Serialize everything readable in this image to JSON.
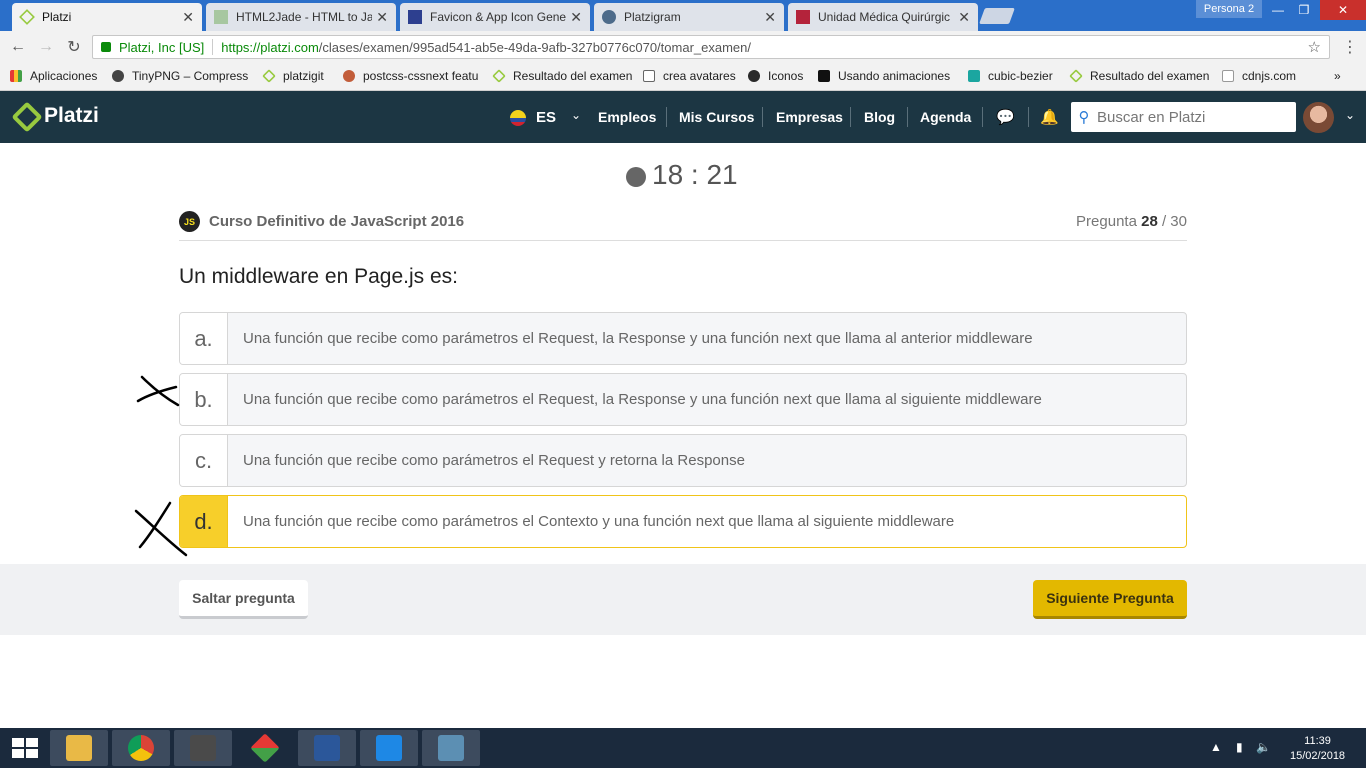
{
  "browser": {
    "tabs": [
      {
        "title": "Platzi",
        "active": true
      },
      {
        "title": "HTML2Jade - HTML to Ja",
        "active": false
      },
      {
        "title": "Favicon & App Icon Gene",
        "active": false
      },
      {
        "title": "Platzigram",
        "active": false
      },
      {
        "title": "Unidad Médica Quirúrgic",
        "active": false
      }
    ],
    "profile": "Persona 2",
    "secure_label": "Platzi, Inc [US]",
    "url_host": "https://platzi.com",
    "url_path": "/clases/examen/995ad541-ab5e-49da-9afb-327b0776c070/tomar_examen/",
    "bookmarks": [
      "Aplicaciones",
      "TinyPNG – Compress",
      "platzigit",
      "postcss-cssnext featu",
      "Resultado del examen",
      "crea avatares",
      "Iconos",
      "Usando animaciones",
      "cubic-bezier",
      "Resultado del examen",
      "cdnjs.com"
    ],
    "bookmarks_more": "»"
  },
  "header": {
    "logo": "Platzi",
    "lang": "ES",
    "nav": [
      "Empleos",
      "Mis Cursos",
      "Empresas",
      "Blog",
      "Agenda"
    ],
    "search_placeholder": "Buscar en Platzi"
  },
  "exam": {
    "timer": "18 : 21",
    "course_badge": "JS",
    "course": "Curso Definitivo de JavaScript 2016",
    "progress_label": "Pregunta",
    "progress_current": "28",
    "progress_total": "/ 30",
    "question": "Un middleware en Page.js es:",
    "options": [
      {
        "letter": "a.",
        "text": "Una función que recibe como parámetros el Request, la Response y una función next que llama al anterior middleware"
      },
      {
        "letter": "b.",
        "text": "Una función que recibe como parámetros el Request, la Response y una función next que llama al siguiente middleware"
      },
      {
        "letter": "c.",
        "text": "Una función que recibe como parámetros el Request y retorna la Response"
      },
      {
        "letter": "d.",
        "text": "Una función que recibe como parámetros el Contexto y una función next que llama al siguiente middleware"
      }
    ],
    "selected_option": "d."
  },
  "footer": {
    "skip": "Saltar pregunta",
    "next": "Siguiente Pregunta"
  },
  "taskbar": {
    "time": "11:39",
    "date": "15/02/2018"
  },
  "colors": {
    "header_bg": "#1c3643",
    "brand_green": "#98ca3f",
    "selected_yellow": "#f7cf2a",
    "next_button": "#e3b800"
  }
}
